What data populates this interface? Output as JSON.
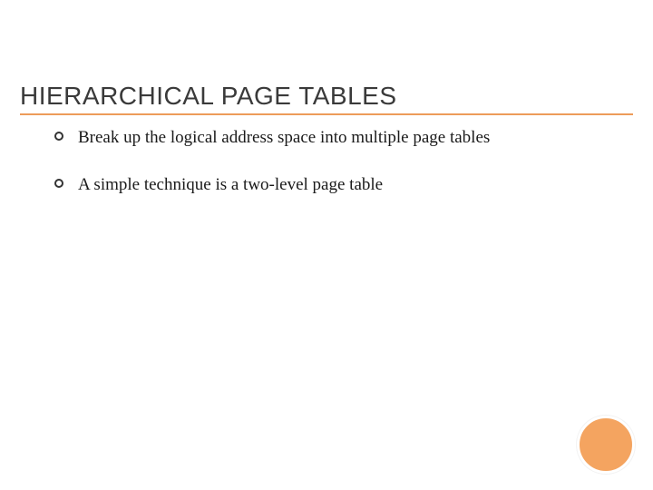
{
  "title": "HIERARCHICAL PAGE TABLES",
  "bullets": [
    {
      "text": "Break up the logical address space into multiple page tables"
    },
    {
      "text": "A simple technique is a two-level page table"
    }
  ],
  "accent_color": "#ed9c5a",
  "circle_color": "#f4a460"
}
